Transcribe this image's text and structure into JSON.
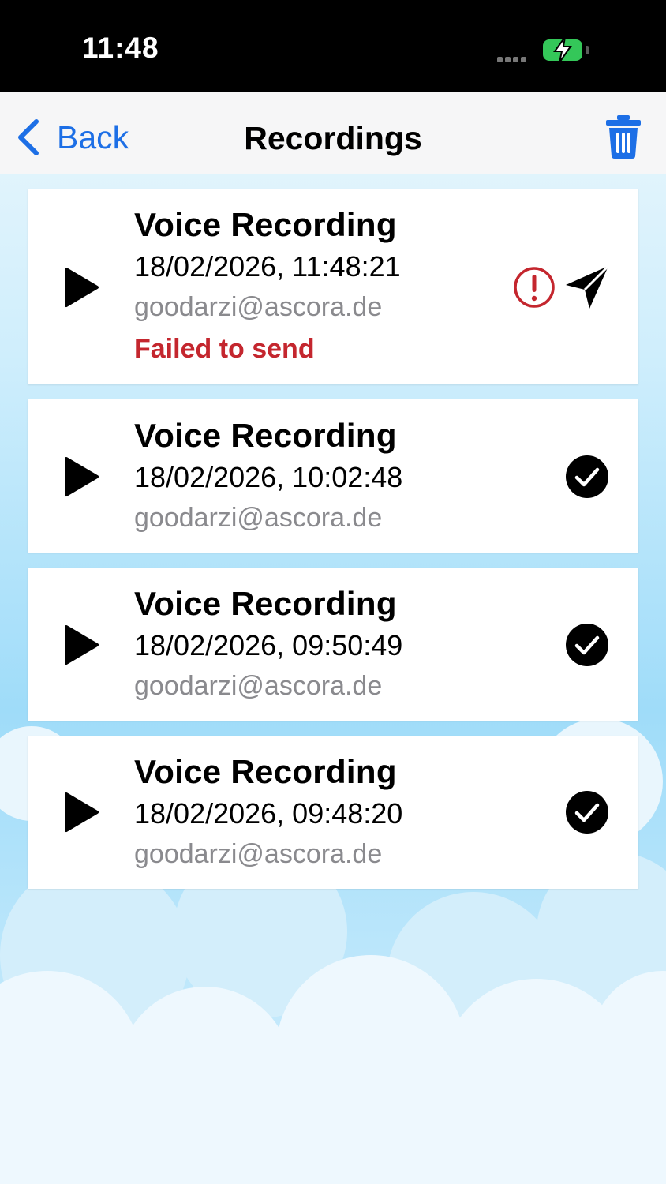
{
  "status_bar": {
    "time": "11:48",
    "battery_icon": "battery-charging-icon",
    "signal_icon": "signal-icon"
  },
  "nav": {
    "back_label": "Back",
    "title": "Recordings",
    "back_icon": "chevron-left-icon",
    "trash_icon": "trash-icon"
  },
  "colors": {
    "accent": "#1d6fe6",
    "error": "#c4262e",
    "secondary_text": "#8a8a8e",
    "battery": "#34c759"
  },
  "recordings": [
    {
      "title": "Voice Recording",
      "datetime": "18/02/2026, 11:48:21",
      "email": "goodarzi@ascora.de",
      "status": "Failed to send",
      "status_icons": [
        "alert-circle-icon",
        "send-icon"
      ]
    },
    {
      "title": "Voice Recording",
      "datetime": "18/02/2026, 10:02:48",
      "email": "goodarzi@ascora.de",
      "status_icons": [
        "check-circle-icon"
      ]
    },
    {
      "title": "Voice Recording",
      "datetime": "18/02/2026, 09:50:49",
      "email": "goodarzi@ascora.de",
      "status_icons": [
        "check-circle-icon"
      ]
    },
    {
      "title": "Voice Recording",
      "datetime": "18/02/2026, 09:48:20",
      "email": "goodarzi@ascora.de",
      "status_icons": [
        "check-circle-icon"
      ]
    }
  ]
}
